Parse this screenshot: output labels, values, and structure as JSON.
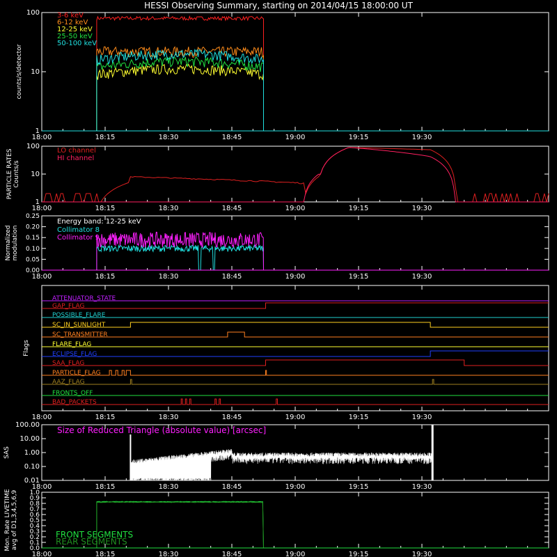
{
  "title": "HESSI Observing Summary, starting on 2014/04/15 18:00:00 UT",
  "time_axis": {
    "start": "18:00",
    "end": "20:00",
    "ticks": [
      "18:00",
      "18:15",
      "18:30",
      "18:45",
      "19:00",
      "19:15",
      "19:30"
    ],
    "tick_minutes": [
      0,
      15,
      30,
      45,
      60,
      75,
      90
    ]
  },
  "chart_data": [
    {
      "type": "line",
      "id": "count-rates",
      "ylabel": "counts/s/detector",
      "yscale": "log",
      "ylim": [
        1,
        100
      ],
      "yticks": [
        "1",
        "10",
        "100"
      ],
      "data_interval_minutes": [
        13,
        52.5
      ],
      "series": [
        {
          "name": "3-6 keV",
          "color": "#ff2020",
          "level": 80
        },
        {
          "name": "6-12 keV",
          "color": "#ff8c1a",
          "level": 22
        },
        {
          "name": "12-25 keV",
          "color": "#ffff30",
          "level": 9
        },
        {
          "name": "25-50 keV",
          "color": "#20e040",
          "level": 12
        },
        {
          "name": "50-100 keV",
          "color": "#20e0e0",
          "level": 16
        }
      ]
    },
    {
      "type": "line",
      "id": "particle-rates",
      "ylabel": "PARTICLE RATES Counts/s",
      "yscale": "log",
      "ylim": [
        1,
        100
      ],
      "yticks": [
        "1",
        "10",
        "100"
      ],
      "series": [
        {
          "name": "LO channel",
          "color": "#e02020"
        },
        {
          "name": "HI channel",
          "color": "#ff2060"
        }
      ]
    },
    {
      "type": "line",
      "id": "modulation",
      "ylabel": "Normalized modulation",
      "ylim": [
        0,
        0.25
      ],
      "yticks": [
        "0.00",
        "0.05",
        "0.10",
        "0.15",
        "0.20",
        "0.25"
      ],
      "annotation": "Energy band: 12-25 keV",
      "series": [
        {
          "name": "Collimator 8",
          "color": "#20e0e0",
          "level": 0.1
        },
        {
          "name": "Collimator 9",
          "color": "#ff20ff",
          "level": 0.14
        }
      ]
    },
    {
      "type": "line",
      "id": "flags",
      "ylabel": "Flags",
      "series": [
        {
          "name": "ATTENUATOR_STATE",
          "color": "#c020ff"
        },
        {
          "name": "GAP_FLAG",
          "color": "#e02020"
        },
        {
          "name": "POSSIBLE_FLARE",
          "color": "#20d0d0"
        },
        {
          "name": "SC_IN_SUNLIGHT",
          "color": "#ffd020"
        },
        {
          "name": "SC_TRANSMITTER",
          "color": "#ff8020"
        },
        {
          "name": "FLARE_FLAG",
          "color": "#ffff30"
        },
        {
          "name": "ECLIPSE_FLAG",
          "color": "#2040ff"
        },
        {
          "name": "SAA_FLAG",
          "color": "#e02020"
        },
        {
          "name": "PARTICLE_FLAG",
          "color": "#ff8020"
        },
        {
          "name": "AAZ_FLAG",
          "color": "#a08020"
        },
        {
          "name": "FRONTS_OFF",
          "color": "#20e040"
        },
        {
          "name": "BAD_PACKETS",
          "color": "#e02020"
        }
      ]
    },
    {
      "type": "line",
      "id": "sas",
      "ylabel": "SAS",
      "yscale": "log",
      "ylim": [
        0.01,
        100
      ],
      "yticks": [
        "0.01",
        "0.10",
        "1.00",
        "10.00",
        "100.00"
      ],
      "annotation": "Size of Reduced Triangle (absolute value) [arcsec]",
      "annotation_color": "#ff20ff"
    },
    {
      "type": "line",
      "id": "livetime",
      "ylabel": "Mon. Rate LIVETIME avg of D1,3,4,5,6,9",
      "ylim": [
        0,
        1.0
      ],
      "yticks": [
        "0.0",
        "0.1",
        "0.2",
        "0.3",
        "0.4",
        "0.5",
        "0.6",
        "0.7",
        "0.8",
        "0.9",
        "1.0"
      ],
      "series": [
        {
          "name": "FRONT SEGMENTS",
          "color": "#20e040",
          "level": 0.83
        },
        {
          "name": "REAR SEGMENTS",
          "color": "#209020",
          "level": 0.82
        }
      ]
    }
  ]
}
